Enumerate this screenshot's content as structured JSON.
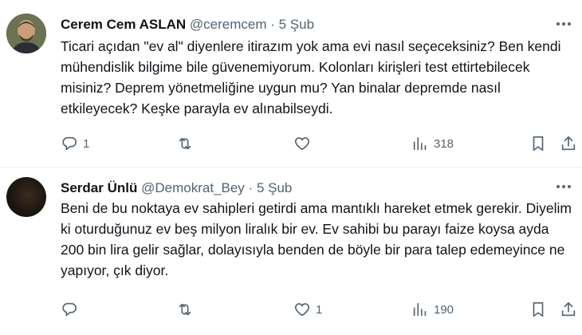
{
  "tweets": [
    {
      "name": "Cerem Cem ASLAN",
      "handle": "@ceremcem",
      "separator": "·",
      "date": "5 Şub",
      "text": "Ticari açıdan \"ev al\" diyenlere itirazım yok ama evi nasıl seçeceksiniz? Ben kendi mühendislik bilgime bile güvenemiyorum. Kolonları kirişleri test ettirtebilecek misiniz? Deprem yönetmeliğine uygun mu? Yan binalar depremde nasıl etkileyecek? Keşke parayla ev alınabilseydi.",
      "replies": "1",
      "retweets": "",
      "likes": "",
      "views": "318",
      "icons": {
        "reply": "reply-icon",
        "retweet": "retweet-icon",
        "like": "heart-icon",
        "views": "views-icon",
        "bookmark": "bookmark-icon",
        "share": "share-icon",
        "more": "more-icon"
      }
    },
    {
      "name": "Serdar Ünlü",
      "handle": "@Demokrat_Bey",
      "separator": "·",
      "date": "5 Şub",
      "text": "Beni de bu noktaya ev sahipleri getirdi ama mantıklı hareket etmek gerekir. Diyelim ki oturduğunuz ev beş milyon liralık bir ev. Ev sahibi bu parayı faize koysa ayda 200 bin lira gelir sağlar, dolayısıyla benden de böyle bir para talep edemeyince ne yapıyor, çık diyor.",
      "replies": "",
      "retweets": "",
      "likes": "1",
      "views": "190",
      "icons": {
        "reply": "reply-icon",
        "retweet": "retweet-icon",
        "like": "heart-icon",
        "views": "views-icon",
        "bookmark": "bookmark-icon",
        "share": "share-icon",
        "more": "more-icon"
      }
    }
  ],
  "colors": {
    "text": "#0f1419",
    "secondary": "#536471",
    "divider": "#eff3f4",
    "background": "#ffffff"
  }
}
